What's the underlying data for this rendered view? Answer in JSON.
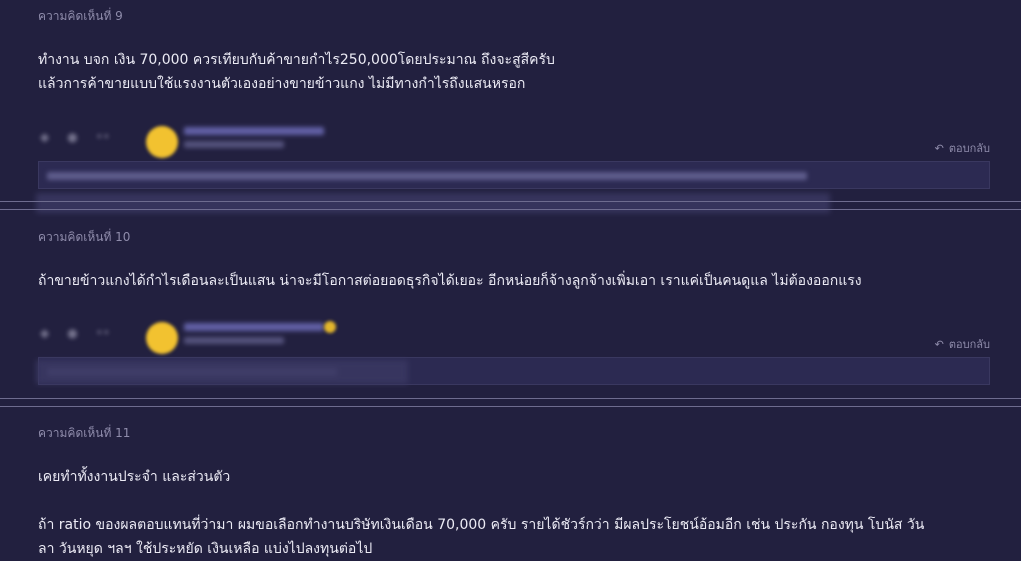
{
  "comments": [
    {
      "label": "ความคิดเห็นที่ 9",
      "lines": [
        "ทำงาน บจก เงิน 70,000 ควรเทียบกับค้าขายกำไร250,000โดยประมาณ ถึงจะสูสีครับ",
        "แล้วการค้าขายแบบใช้แรงงานตัวเองอย่างขายข้าวแกง ไม่มีทางกำไรถึงแสนหรอก"
      ],
      "reply_label": "ตอบกลับ"
    },
    {
      "label": "ความคิดเห็นที่ 10",
      "lines": [
        "ถ้าขายข้าวแกงได้กำไรเดือนละเป็นแสน น่าจะมีโอกาสต่อยอดธุรกิจได้เยอะ อีกหน่อยก็จ้างลูกจ้างเพิ่มเอา เราแค่เป็นคนดูแล ไม่ต้องออกแรง"
      ],
      "reply_label": "ตอบกลับ"
    },
    {
      "label": "ความคิดเห็นที่ 11",
      "lines": [
        "เคยทำทั้งงานประจำ และส่วนตัว",
        "",
        "ถ้า ratio ของผลตอบแทนที่ว่ามา ผมขอเลือกทำงานบริษัทเงินเดือน 70,000 ครับ รายได้ชัวร์กว่า มีผลประโยชน์อ้อมอีก เช่น ประกัน กองทุน โบนัส วัน",
        "ลา วันหยุด ฯลฯ ใช้ประหยัด เงินเหลือ แบ่งไปลงทุนต่อไป"
      ]
    }
  ],
  "icons": {
    "like": "thumb-icon",
    "emotion": "smile-icon",
    "reply": "reply-arrow-icon"
  },
  "colors": {
    "background": "#22203f",
    "avatar": "#f2c230"
  }
}
